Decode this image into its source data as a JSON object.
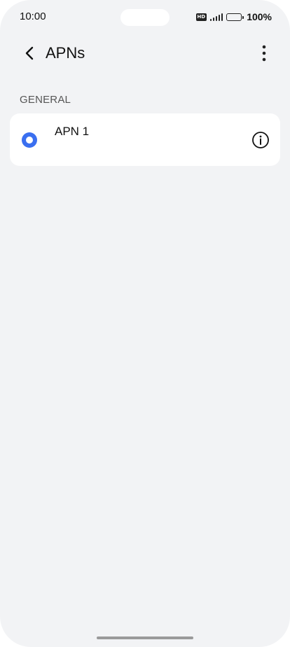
{
  "status_bar": {
    "time": "10:00",
    "network_badge": "HD",
    "battery_percent": "100%",
    "signal_icon": "signal-bars-icon",
    "battery_icon": "battery-full-icon"
  },
  "header": {
    "title": "APNs",
    "back_icon": "chevron-left-icon",
    "more_icon": "more-vertical-icon"
  },
  "sections": [
    {
      "label": "GENERAL",
      "items": [
        {
          "name": "APN 1",
          "selected": true,
          "info_icon": "info-circle-icon"
        }
      ]
    }
  ],
  "colors": {
    "accent": "#3a6ff0",
    "background": "#f2f3f5",
    "card": "#ffffff",
    "text_primary": "#111111",
    "text_secondary": "#555555"
  }
}
